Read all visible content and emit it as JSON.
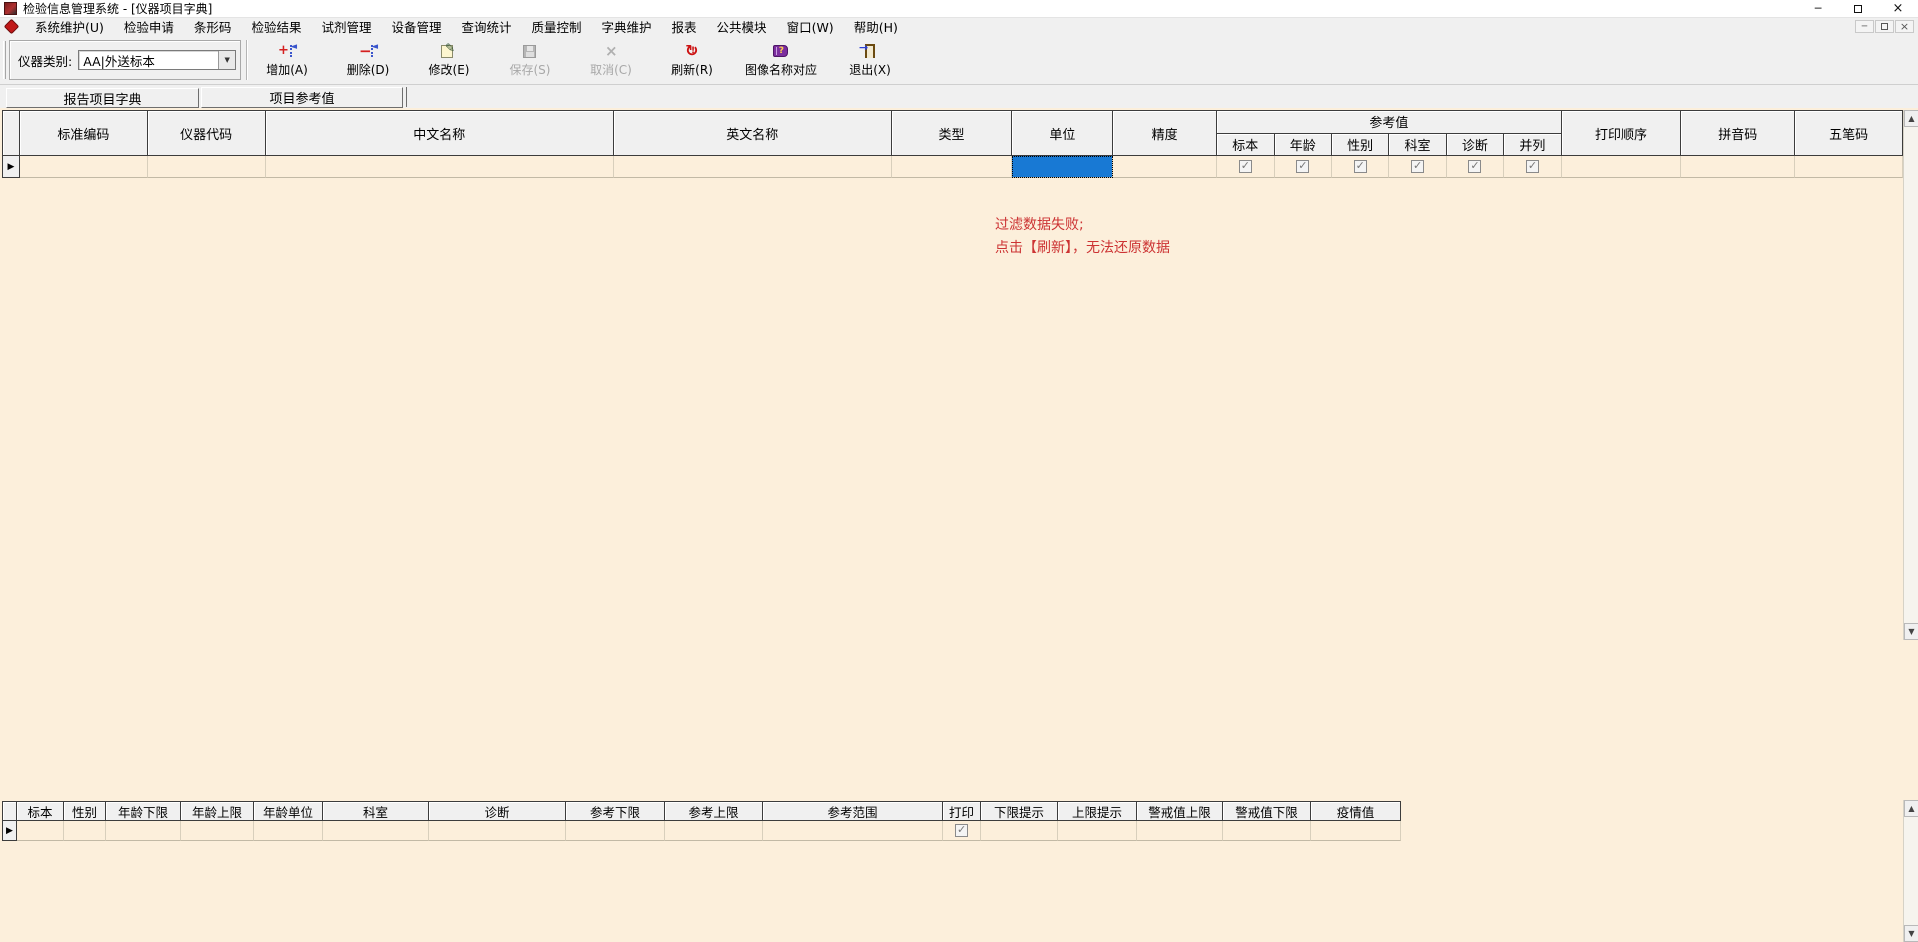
{
  "titlebar": {
    "title": "检验信息管理系统 - [仪器项目字典]"
  },
  "menu_bar": {
    "items": [
      "系统维护(U)",
      "检验申请",
      "条形码",
      "检验结果",
      "试剂管理",
      "设备管理",
      "查询统计",
      "质量控制",
      "字典维护",
      "报表",
      "公共模块",
      "窗口(W)",
      "帮助(H)"
    ]
  },
  "toolbar": {
    "category_label": "仪器类别:",
    "category_value": "AA|外送标本",
    "buttons": [
      {
        "label": "增加(A)",
        "enabled": true
      },
      {
        "label": "删除(D)",
        "enabled": true
      },
      {
        "label": "修改(E)",
        "enabled": true
      },
      {
        "label": "保存(S)",
        "enabled": false
      },
      {
        "label": "取消(C)",
        "enabled": false
      },
      {
        "label": "刷新(R)",
        "enabled": true
      },
      {
        "label": "图像名称对应",
        "enabled": true
      },
      {
        "label": "退出(X)",
        "enabled": true
      }
    ]
  },
  "tab_bar": {
    "tabs": [
      {
        "label": "报告项目字典",
        "active": false
      },
      {
        "label": "项目参考值",
        "active": true
      }
    ]
  },
  "main_grid": {
    "columns": [
      "标准编码",
      "仪器代码",
      "中文名称",
      "英文名称",
      "类型",
      "单位",
      "精度"
    ],
    "ref_group": {
      "label": "参考值",
      "sub_columns": [
        "标本",
        "年龄",
        "性别",
        "科室",
        "诊断",
        "并列"
      ]
    },
    "tail_columns": [
      "打印顺序",
      "拼音码",
      "五笔码"
    ],
    "row": {
      "selected_column": "单位",
      "ref_checks": [
        true,
        true,
        true,
        true,
        true,
        true
      ]
    }
  },
  "message": {
    "line1": "过滤数据失败;",
    "line2": "点击【刷新】，无法还原数据"
  },
  "bottom_grid": {
    "columns": [
      "标本",
      "性别",
      "年龄下限",
      "年龄上限",
      "年龄单位",
      "科室",
      "诊断",
      "参考下限",
      "参考上限",
      "参考范围",
      "打印",
      "下限提示",
      "上限提示",
      "警戒值上限",
      "警戒值下限",
      "疫情值"
    ],
    "row": {
      "print_checked": true
    }
  },
  "colors": {
    "content_bg": "#fcefdb",
    "selection": "#1879d4",
    "error_text": "#cc3333"
  }
}
